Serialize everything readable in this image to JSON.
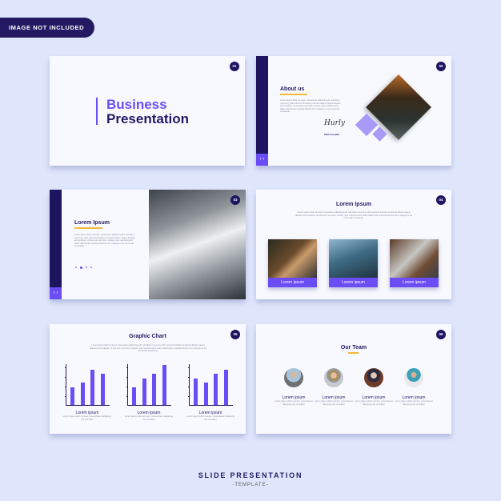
{
  "badge": "IMAGE NOT INCLUDED",
  "footer": {
    "title": "SLIDE PRESENTATION",
    "subtitle": "-TEMPLATE-"
  },
  "colors": {
    "navy": "#1e1560",
    "accent": "#6b4df5",
    "underline": "#f5b935",
    "background": "#dfe6fb"
  },
  "lorem": "Lorem ipsum dolor sit amet, consectetur adipiscing elit, sed diam nonummy nibh euismod tincidunt ut laoreet dolore magna aliquam erat volutpat. Ut wisi enim ad minim veniam, quis nostrud exerci tation ullamcorper suscipit lobortis nisl ut aliquip ex ea commodo consequat.",
  "lorem_short": "Lorem ipsum dolor sit amet, consectetuer adipiscing elit, sed diam",
  "slides": {
    "s1": {
      "num": "01",
      "title1": "Business",
      "title2": "Presentation"
    },
    "s2": {
      "num": "02",
      "title": "About us",
      "signature": "Hurly",
      "role": "CEO Founder",
      "nav": "‹ ›"
    },
    "s3": {
      "num": "03",
      "title": "Lorem Ipsum",
      "nav": "‹ ›"
    },
    "s4": {
      "num": "04",
      "title": "Lorem Ipsum",
      "cards": [
        "Lorem ipsum",
        "Lorem ipsum",
        "Lorem ipsum"
      ]
    },
    "s5": {
      "num": "05",
      "title": "Graphic Chart",
      "charts": [
        {
          "label": "Lorem ipsum",
          "values": [
            2,
            2.5,
            4,
            3.5
          ]
        },
        {
          "label": "Lorem ipsum",
          "values": [
            2,
            3,
            3.5,
            4.5
          ]
        },
        {
          "label": "Lorem ipsum",
          "values": [
            3,
            2.5,
            3.5,
            4
          ]
        }
      ],
      "ymax": 4.5
    },
    "s6": {
      "num": "06",
      "title": "Our Team",
      "members": [
        "Lorem ipsum",
        "Lorem ipsum",
        "Lorem ipsum",
        "Lorem ipsum"
      ]
    }
  }
}
